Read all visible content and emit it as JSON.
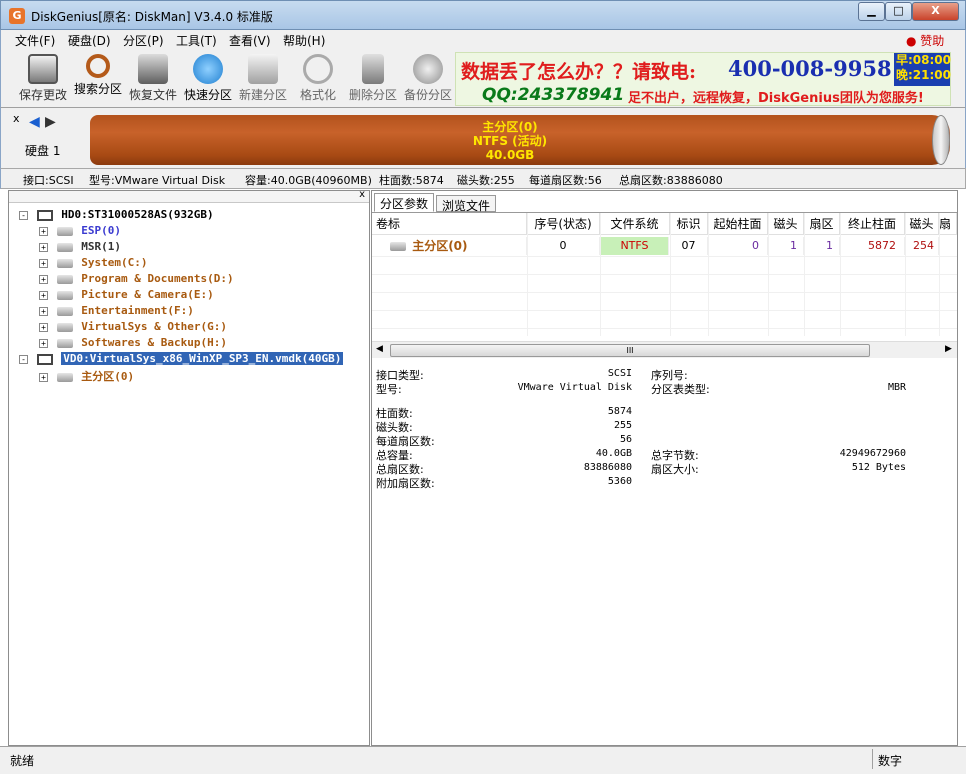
{
  "window": {
    "app_icon_glyph": "G",
    "title": "DiskGenius[原名: DiskMan] V3.4.0 标准版",
    "min": "▁",
    "max": "□",
    "close": "X"
  },
  "menu": {
    "items": [
      "文件(F)",
      "硬盘(D)",
      "分区(P)",
      "工具(T)",
      "查看(V)",
      "帮助(H)"
    ],
    "sponsor": "● 赞助"
  },
  "toolbar": {
    "buttons": [
      {
        "label": "保存更改",
        "icon": "save-icon",
        "color": "#6b6b6b"
      },
      {
        "label": "搜索分区",
        "icon": "magnifier-icon",
        "color": "#b45a1a"
      },
      {
        "label": "恢复文件",
        "icon": "restore-icon",
        "color": "#5a5a5a"
      },
      {
        "label": "快速分区",
        "icon": "quick-partition-icon",
        "color": "#1f7fd0"
      },
      {
        "label": "新建分区",
        "icon": "new-partition-icon",
        "color": "#8a8a8a"
      },
      {
        "label": "格式化",
        "icon": "format-icon",
        "color": "#9a9a9a"
      },
      {
        "label": "删除分区",
        "icon": "delete-icon",
        "color": "#7a7a7a"
      },
      {
        "label": "备份分区",
        "icon": "backup-icon",
        "color": "#8c8c8c"
      }
    ]
  },
  "ad": {
    "line1": "数据丢了怎么办？？请致电:",
    "phone": "400-008-9958",
    "hours_am": "早:08:00",
    "hours_pm": "晚:21:00",
    "qq": "QQ:243378941",
    "slogan": "足不出户，远程恢复，DiskGenius团队为您服务!"
  },
  "diskbar": {
    "close": "x",
    "prev": "◀",
    "next": "▶",
    "disk_label": "硬盘 1",
    "partition_name": "主分区(0)",
    "partition_fs": "NTFS (活动)",
    "partition_size": "40.0GB",
    "bar_color": "#b8581f"
  },
  "infobar": {
    "interface": "接口:SCSI",
    "model": "型号:VMware Virtual Disk",
    "capacity": "容量:40.0GB(40960MB)",
    "cylinders": "柱面数:5874",
    "heads": "磁头数:255",
    "sectors_per_track": "每道扇区数:56",
    "total_sectors": "总扇区数:83886080"
  },
  "tree": {
    "close": "x",
    "hd0": "HD0:ST31000528AS(932GB)",
    "hd0_parts": [
      {
        "label": "ESP(0)",
        "color": "#3a3ad0"
      },
      {
        "label": "MSR(1)",
        "color": "#333333"
      },
      {
        "label": "System(C:)",
        "color": "#a85a10"
      },
      {
        "label": "Program & Documents(D:)",
        "color": "#a85a10"
      },
      {
        "label": "Picture & Camera(E:)",
        "color": "#a85a10"
      },
      {
        "label": "Entertainment(F:)",
        "color": "#a85a10"
      },
      {
        "label": "VirtualSys & Other(G:)",
        "color": "#a85a10"
      },
      {
        "label": "Softwares & Backup(H:)",
        "color": "#a85a10"
      }
    ],
    "vd0": "VD0:VirtualSys_x86_WinXP_SP3_EN.vmdk(40GB)",
    "vd0_part": "主分区(0)"
  },
  "tabs": {
    "params": "分区参数",
    "browse": "浏览文件"
  },
  "grid": {
    "headers": [
      "卷标",
      "序号(状态)",
      "文件系统",
      "标识",
      "起始柱面",
      "磁头",
      "扇区",
      "终止柱面",
      "磁头",
      "扇"
    ],
    "row": {
      "label": "主分区(0)",
      "index": "0",
      "fs": "NTFS",
      "id": "07",
      "start_cyl": "0",
      "start_head": "1",
      "start_sector": "1",
      "end_cyl": "5872",
      "end_head": "254"
    }
  },
  "scroll": {
    "left": "◀",
    "thumb": "III",
    "right": "▶"
  },
  "details": {
    "iface_label": "接口类型:",
    "iface_value": "SCSI",
    "serial_label": "序列号:",
    "model_label": "型号:",
    "model_value": "VMware Virtual Disk",
    "pt_label": "分区表类型:",
    "pt_value": "MBR",
    "cyl_label": "柱面数:",
    "cyl_value": "5874",
    "heads_label": "磁头数:",
    "heads_value": "255",
    "spt_label": "每道扇区数:",
    "spt_value": "56",
    "cap_label": "总容量:",
    "cap_value": "40.0GB",
    "bytes_label": "总字节数:",
    "bytes_value": "42949672960",
    "sectors_label": "总扇区数:",
    "sectors_value": "83886080",
    "sector_size_label": "扇区大小:",
    "sector_size_value": "512 Bytes",
    "extra_label": "附加扇区数:",
    "extra_value": "5360"
  },
  "status": {
    "text": "就绪",
    "num": "数字"
  }
}
